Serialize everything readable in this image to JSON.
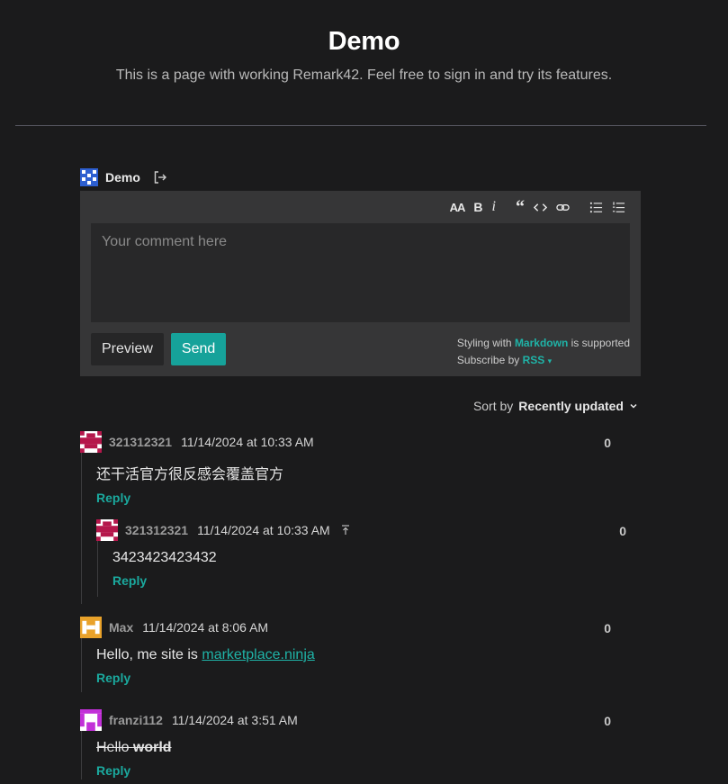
{
  "page": {
    "title": "Demo",
    "subtitle": "This is a page with working Remark42. Feel free to sign in and try its features."
  },
  "user": {
    "name": "Demo"
  },
  "editor": {
    "toolbar": [
      "header-icon",
      "bold-icon",
      "italic-icon",
      "quote-icon",
      "code-icon",
      "link-icon",
      "unordered-list-icon",
      "ordered-list-icon"
    ],
    "placeholder": "Your comment here",
    "preview_label": "Preview",
    "send_label": "Send",
    "styling_prefix": "Styling with",
    "styling_link": "Markdown",
    "styling_suffix": "is supported",
    "subscribe_prefix": "Subscribe by",
    "subscribe_link": "RSS",
    "subscribe_caret": "▾"
  },
  "sort": {
    "label": "Sort by",
    "value": "Recently updated"
  },
  "comments": [
    {
      "author": "321312321",
      "time": "11/14/2024 at 10:33 AM",
      "text": "还干活官方很反感会覆盖官方",
      "score": "0",
      "reply": "Reply"
    },
    {
      "author": "321312321",
      "time": "11/14/2024 at 10:33 AM",
      "text": "3423423423432",
      "score": "0",
      "reply": "Reply"
    },
    {
      "author": "Max",
      "time": "11/14/2024 at 8:06 AM",
      "text_prefix": "Hello, me site is ",
      "link": "marketplace.ninja",
      "score": "0",
      "reply": "Reply"
    },
    {
      "author": "franzi112",
      "time": "11/14/2024 at 3:51 AM",
      "text_plain": "Hello ",
      "text_bold": "world",
      "score": "0",
      "reply": "Reply"
    }
  ],
  "colors": {
    "accent": "#16a29a",
    "background": "#1b1b1c",
    "editor": "#363637"
  }
}
